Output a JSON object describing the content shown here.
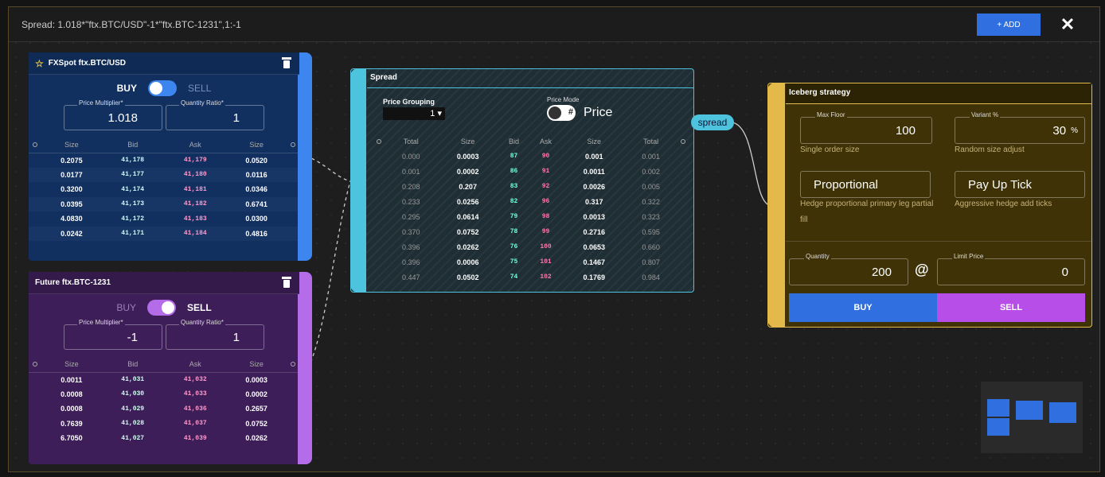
{
  "topbar": {
    "title": "Spread: 1.018*\"ftx.BTC/USD\"-1*\"ftx.BTC-1231\",1:-1",
    "add_label": "+ ADD",
    "close_label": "✕"
  },
  "leg1": {
    "title": "FXSpot ftx.BTC/USD",
    "buy_label": "BUY",
    "sell_label": "SELL",
    "price_multiplier_label": "Price Multiplier*",
    "price_multiplier": "1.018",
    "quantity_ratio_label": "Quantity Ratio*",
    "quantity_ratio": "1",
    "columns": [
      "Size",
      "Bid",
      "Ask",
      "Size"
    ],
    "rows": [
      [
        "0.2075",
        "41,178",
        "41,179",
        "0.0520"
      ],
      [
        "0.0177",
        "41,177",
        "41,180",
        "0.0116"
      ],
      [
        "0.3200",
        "41,174",
        "41,181",
        "0.0346"
      ],
      [
        "0.0395",
        "41,173",
        "41,182",
        "0.6741"
      ],
      [
        "4.0830",
        "41,172",
        "41,183",
        "0.0300"
      ],
      [
        "0.0242",
        "41,171",
        "41,184",
        "0.4816"
      ]
    ]
  },
  "leg2": {
    "title": "Future ftx.BTC-1231",
    "buy_label": "BUY",
    "sell_label": "SELL",
    "price_multiplier_label": "Price Multiplier*",
    "price_multiplier": "-1",
    "quantity_ratio_label": "Quantity Ratio*",
    "quantity_ratio": "1",
    "columns": [
      "Size",
      "Bid",
      "Ask",
      "Size"
    ],
    "rows": [
      [
        "0.0011",
        "41,031",
        "41,032",
        "0.0003"
      ],
      [
        "0.0008",
        "41,030",
        "41,033",
        "0.0002"
      ],
      [
        "0.0008",
        "41,029",
        "41,036",
        "0.2657"
      ],
      [
        "0.7639",
        "41,028",
        "41,037",
        "0.0752"
      ],
      [
        "6.7050",
        "41,027",
        "41,039",
        "0.0262"
      ]
    ]
  },
  "spread": {
    "title": "Spread",
    "price_grouping_label": "Price Grouping",
    "price_grouping_value": "1 ▾",
    "price_mode_label": "Price Mode",
    "price_mode_hash": "#",
    "price_mode_value": "Price",
    "columns": [
      "Total",
      "Size",
      "Bid",
      "Ask",
      "Size",
      "Total"
    ],
    "rows": [
      [
        "0.000",
        "0.0003",
        "87",
        "90",
        "0.001",
        "0.001"
      ],
      [
        "0.001",
        "0.0002",
        "86",
        "91",
        "0.0011",
        "0.002"
      ],
      [
        "0.208",
        "0.207",
        "83",
        "92",
        "0.0026",
        "0.005"
      ],
      [
        "0.233",
        "0.0256",
        "82",
        "96",
        "0.317",
        "0.322"
      ],
      [
        "0.295",
        "0.0614",
        "79",
        "98",
        "0.0013",
        "0.323"
      ],
      [
        "0.370",
        "0.0752",
        "78",
        "99",
        "0.2716",
        "0.595"
      ],
      [
        "0.396",
        "0.0262",
        "76",
        "100",
        "0.0653",
        "0.660"
      ],
      [
        "0.396",
        "0.0006",
        "75",
        "101",
        "0.1467",
        "0.807"
      ],
      [
        "0.447",
        "0.0502",
        "74",
        "102",
        "0.1769",
        "0.984"
      ]
    ],
    "port_label": "spread"
  },
  "iceberg": {
    "title": "Iceberg strategy",
    "max_floor_label": "Max Floor",
    "max_floor": "100",
    "max_floor_help": "Single order size",
    "variant_label": "Variant %",
    "variant": "30",
    "variant_unit": "%",
    "variant_help": "Random size adjust",
    "hedge_mode": "Proportional",
    "hedge_help": "Hedge proportional primary leg partial fill",
    "payup": "Pay Up Tick",
    "payup_help": "Aggressive hedge add ticks",
    "quantity_label": "Quantity",
    "quantity": "200",
    "at_sign": "@",
    "limit_price_label": "Limit Price",
    "limit_price": "0",
    "buy_label": "BUY",
    "sell_label": "SELL"
  },
  "colors": {
    "buy_accent": "#2f6fe0",
    "sell_accent": "#b84ee8",
    "spread_accent": "#4ec3dd",
    "iceberg_accent": "#e3b94a"
  }
}
